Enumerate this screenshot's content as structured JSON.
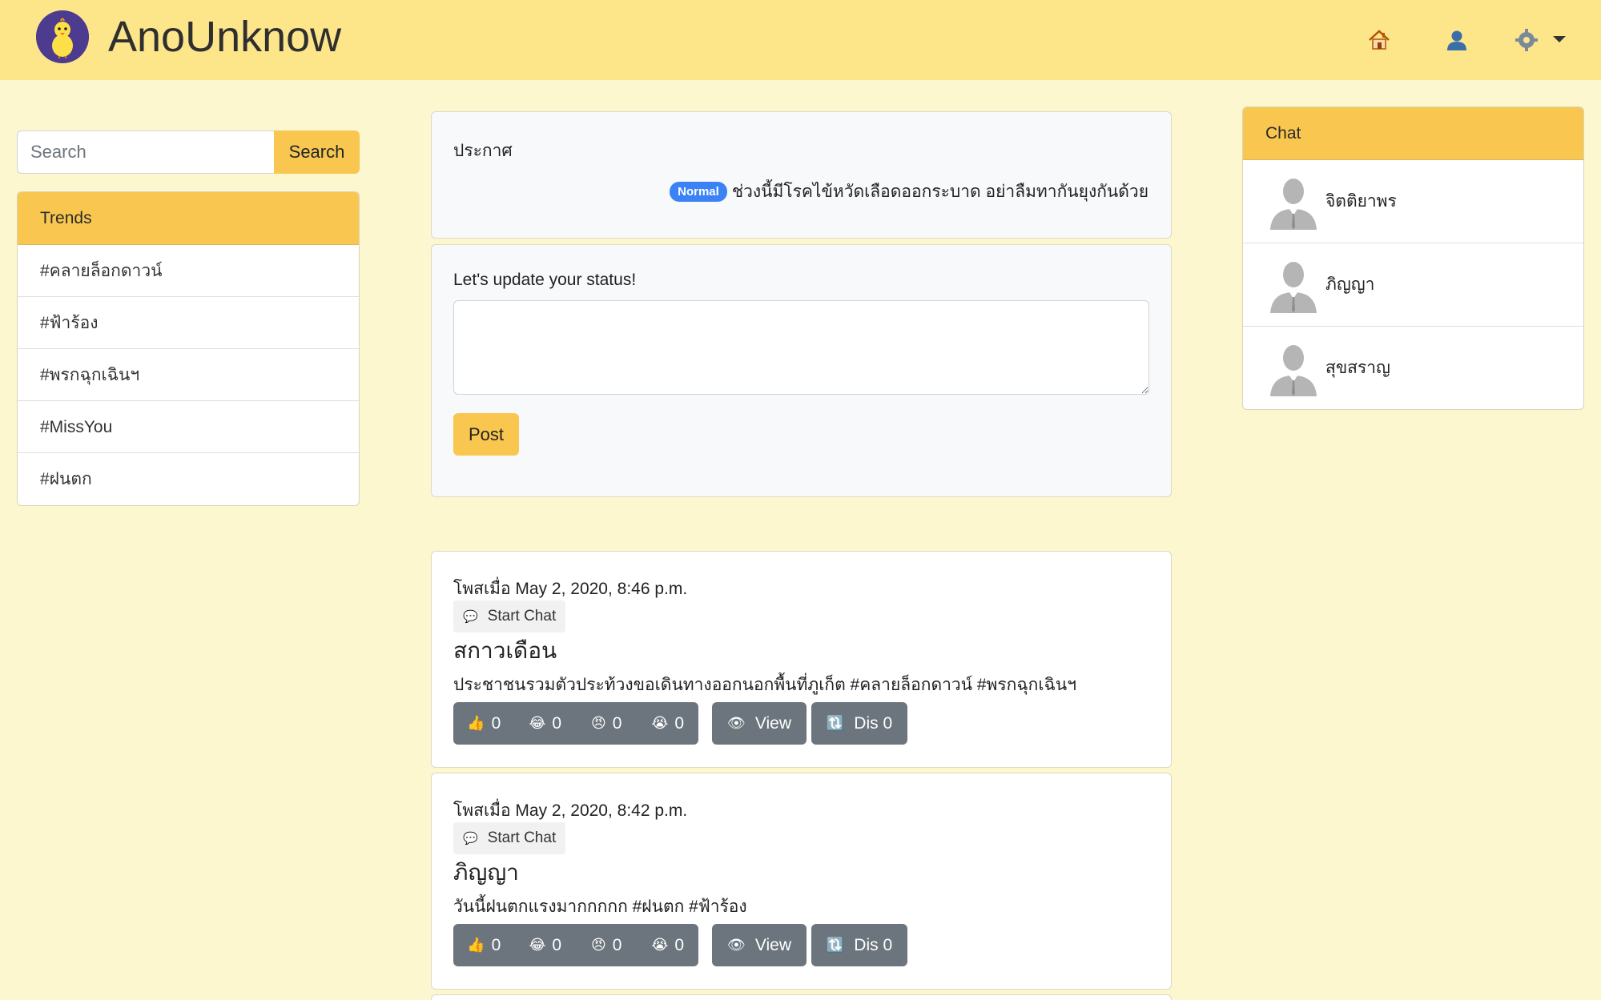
{
  "navbar": {
    "brand": "AnoUnknow",
    "icons": [
      "home-icon",
      "user-icon",
      "gear-icon"
    ]
  },
  "search": {
    "placeholder": "Search",
    "button_label": "Search"
  },
  "trends": {
    "title": "Trends",
    "items": [
      "#คลายล็อกดาวน์",
      "#ฟ้าร้อง",
      "#พรกฉุกเฉินฯ",
      "#MissYou",
      "#ฝนตก"
    ]
  },
  "announcement": {
    "title": "ประกาศ",
    "badge": "Normal",
    "text": "ช่วงนี้มีโรคไข้หวัดเลือดออกระบาด อย่าลืมทากันยุงกันด้วย"
  },
  "status": {
    "label": "Let's update your status!",
    "value": "",
    "post_label": "Post"
  },
  "posts": [
    {
      "date": "โพสเมื่อ May 2, 2020, 8:46 p.m.",
      "chat_label": "Start Chat",
      "author": "สกาวเดือน",
      "body": "ประชาชนรวมตัวประท้วงขอเดินทางออกนอกพื้นที่ภูเก็ต #คลายล็อกดาวน์ #พรกฉุกเฉินฯ",
      "likes": "0",
      "laughs": "0",
      "angry": "0",
      "cry": "0",
      "view_label": "View",
      "dis_label": "Dis 0"
    },
    {
      "date": "โพสเมื่อ May 2, 2020, 8:42 p.m.",
      "chat_label": "Start Chat",
      "author": "ภิญญา",
      "body": "วันนี้ฝนตกแรงมากกกกก #ฝนตก #ฟ้าร้อง",
      "likes": "0",
      "laughs": "0",
      "angry": "0",
      "cry": "0",
      "view_label": "View",
      "dis_label": "Dis 0"
    }
  ],
  "chat": {
    "title": "Chat",
    "contacts": [
      "จิตติยาพร",
      "ภิญญา",
      "สุขสราญ"
    ]
  },
  "colors": {
    "navbar": "#fde68a",
    "background": "#fcf7cf",
    "accent": "#f9c74f",
    "badge": "#3b82f6",
    "button_gray": "#6c757d"
  }
}
